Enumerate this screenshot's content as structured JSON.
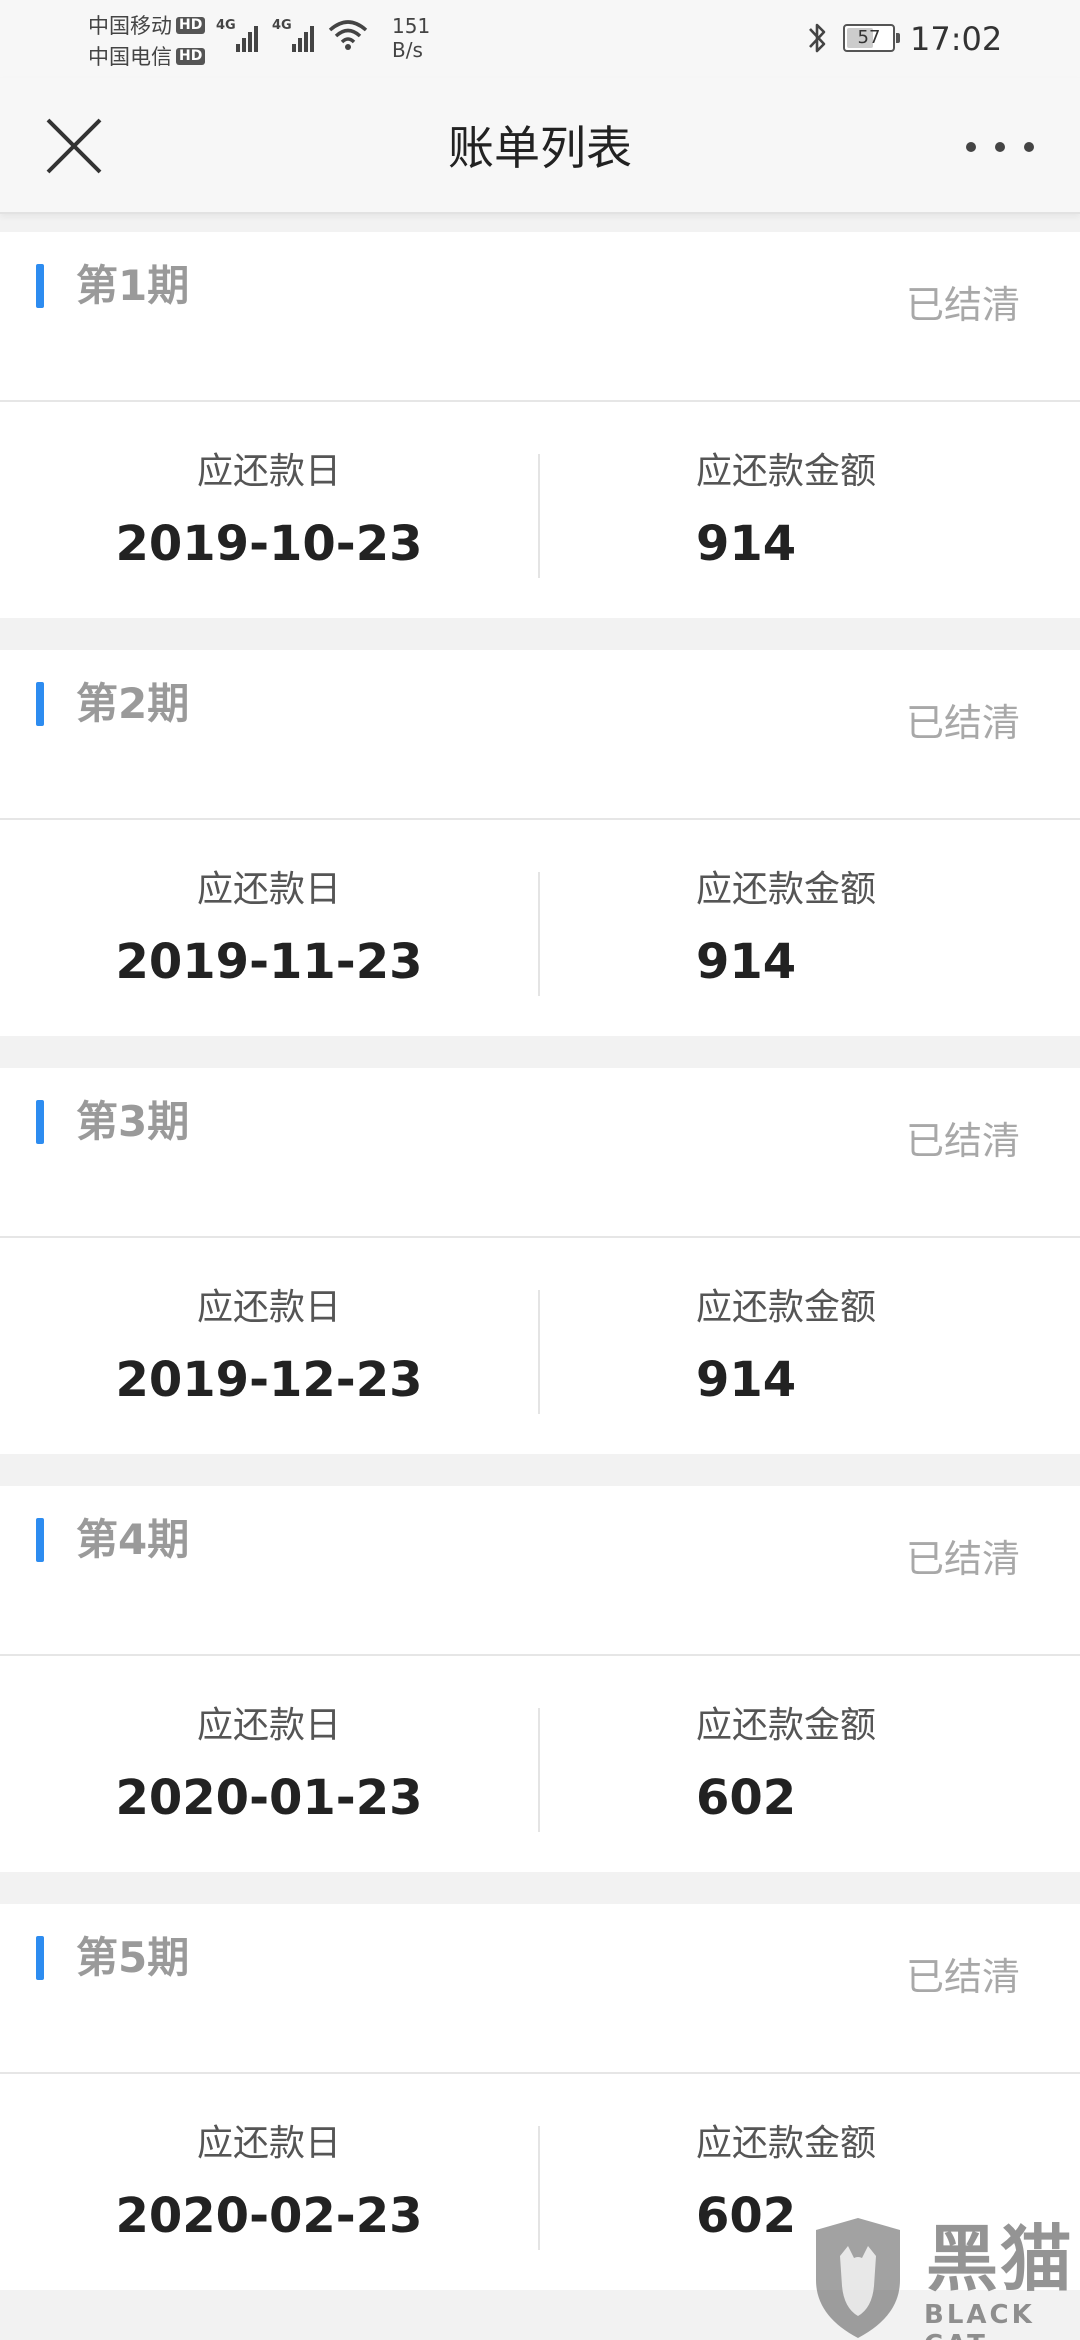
{
  "status_bar": {
    "carrier_1": "中国移动",
    "carrier_2": "中国电信",
    "hd_badge": "HD",
    "network_tag": "4G",
    "net_speed_value": "151",
    "net_speed_unit": "B/s",
    "battery_level": "57",
    "time": "17:02"
  },
  "nav": {
    "title": "账单列表"
  },
  "bills": [
    {
      "period": "第1期",
      "status": "已结清",
      "due_date_label": "应还款日",
      "due_date": "2019-10-23",
      "amount_label": "应还款金额",
      "amount": "914"
    },
    {
      "period": "第2期",
      "status": "已结清",
      "due_date_label": "应还款日",
      "due_date": "2019-11-23",
      "amount_label": "应还款金额",
      "amount": "914"
    },
    {
      "period": "第3期",
      "status": "已结清",
      "due_date_label": "应还款日",
      "due_date": "2019-12-23",
      "amount_label": "应还款金额",
      "amount": "914"
    },
    {
      "period": "第4期",
      "status": "已结清",
      "due_date_label": "应还款日",
      "due_date": "2020-01-23",
      "amount_label": "应还款金额",
      "amount": "602"
    },
    {
      "period": "第5期",
      "status": "已结清",
      "due_date_label": "应还款日",
      "due_date": "2020-02-23",
      "amount_label": "应还款金额",
      "amount": "602"
    }
  ],
  "watermark": {
    "text": "黑猫",
    "sub": "BLACK CAT"
  },
  "colors": {
    "accent": "#2d8cf0",
    "background": "#f2f2f2",
    "card": "#ffffff"
  }
}
